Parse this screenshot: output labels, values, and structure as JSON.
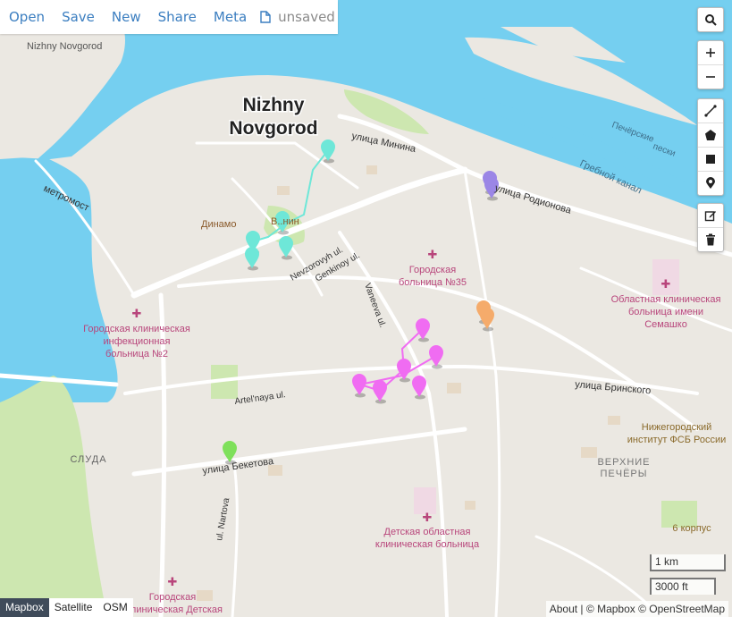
{
  "toolbar": {
    "open": "Open",
    "save": "Save",
    "new": "New",
    "share": "Share",
    "meta": "Meta",
    "status": "unsaved",
    "status_icon": "file-icon"
  },
  "map_labels": {
    "city_line1": "Nizhny",
    "city_line2": "Novgorod",
    "nizhny_corner": "Nizhny Novgorod",
    "minina": "улица Минина",
    "rodionova": "улица Родионова",
    "metromost": "метромост",
    "dinamo": "Динамо",
    "nevzorovyh": "Nevzorovyh ul.",
    "genkinoy": "Genkinoy ul.",
    "vaneeva": "Vaneeva ul.",
    "hosp35_l1": "Городская",
    "hosp35_l2": "больница №35",
    "infect_l1": "Городская клиническая",
    "infect_l2": "инфекционная",
    "infect_l3": "больница №2",
    "oblast_l1": "Областная клиническая",
    "oblast_l2": "больница имени",
    "oblast_l3": "Семашко",
    "pecherskie_l1": "Печёрские",
    "pecherskie_l2": "пески",
    "grebnoy": "Гребной канал",
    "artelnaya": "Artel'naya ul.",
    "brinskogo": "улица Бринского",
    "fsb_l1": "Нижегородский",
    "fsb_l2": "институт ФСБ России",
    "verhnie_l1": "ВЕРХНИЕ",
    "verhnie_l2": "ПЕЧЁРЫ",
    "korpus6": "6 корпус",
    "sluda": "СЛУДА",
    "beketova": "улица Бекетова",
    "nartova": "ul. Nartova",
    "child_l1": "Детская областная",
    "child_l2": "клиническая больница",
    "city_child_l1": "Городская",
    "city_child_l2": "клиническая Детская",
    "stadium_partial": "В..нин"
  },
  "controls": {
    "search": "search-icon",
    "zoom_in": "plus-icon",
    "zoom_out": "minus-icon",
    "draw_line": "line-icon",
    "draw_polygon": "polygon-icon",
    "draw_rect": "square-icon",
    "draw_marker": "marker-icon",
    "edit": "edit-icon",
    "delete": "trash-icon"
  },
  "layers": {
    "mapbox": "Mapbox",
    "satellite": "Satellite",
    "osm": "OSM",
    "active": "Mapbox"
  },
  "attribution": {
    "about": "About",
    "mapbox": "© Mapbox",
    "osm": "© OpenStreetMap",
    "sep": "|"
  },
  "scale": {
    "metric": "1 km",
    "imperial": "3000 ft"
  },
  "colors": {
    "water": "#75cff0",
    "land": "#ebe8e2",
    "park": "#cde7b0",
    "teal_markers": "#6ee7d8",
    "magenta_markers": "#f06cf2",
    "purple_markers": "#9b86e6",
    "orange_markers": "#f5ab6b",
    "green_marker": "#7ee05a",
    "topbar_link": "#3b7ec0"
  }
}
